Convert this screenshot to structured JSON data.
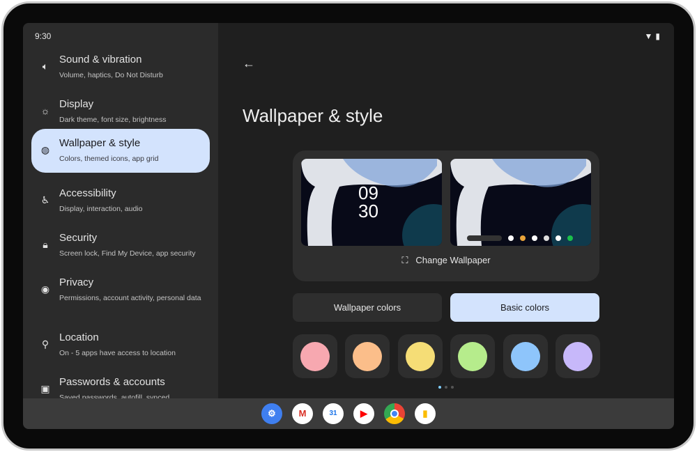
{
  "status": {
    "time": "9:30",
    "wifi_icon": "wifi-icon",
    "battery_icon": "battery-icon"
  },
  "sidebar": {
    "items": [
      {
        "title": "Sound & vibration",
        "subtitle": "Volume, haptics, Do Not Disturb",
        "icon": "volume-icon"
      },
      {
        "title": "Display",
        "subtitle": "Dark theme, font size, brightness",
        "icon": "brightness-icon"
      },
      {
        "title": "Wallpaper & style",
        "subtitle": "Colors, themed icons, app grid",
        "icon": "palette-icon",
        "selected": true
      },
      {
        "title": "Accessibility",
        "subtitle": "Display, interaction, audio",
        "icon": "accessibility-icon"
      },
      {
        "title": "Security",
        "subtitle": "Screen lock, Find My Device, app security",
        "icon": "lock-icon"
      },
      {
        "title": "Privacy",
        "subtitle": "Permissions, account activity, personal data",
        "icon": "eye-icon"
      },
      {
        "title": "Location",
        "subtitle": "On - 5 apps have access to location",
        "icon": "location-pin-icon"
      },
      {
        "title": "Passwords & accounts",
        "subtitle": "Saved passwords, autofill, synced",
        "icon": "account-box-icon"
      }
    ]
  },
  "main": {
    "title": "Wallpaper & style",
    "lock_clock_hours": "09",
    "lock_clock_minutes": "30",
    "change_wallpaper": "Change Wallpaper",
    "tabs": [
      {
        "label": "Wallpaper colors",
        "selected": false
      },
      {
        "label": "Basic colors",
        "selected": true
      }
    ],
    "swatches": [
      "#f7a8b0",
      "#fbbe8a",
      "#f5dd76",
      "#b6ec8c",
      "#8ec5fb",
      "#c7b8fa"
    ],
    "page_indicator": {
      "pages": 3,
      "current": 1
    }
  },
  "accent": "#d3e3fd",
  "taskbar": {
    "apps": [
      "Settings",
      "Gmail",
      "Calendar",
      "YouTube",
      "Chrome",
      "Keep"
    ],
    "calendar_day": "31"
  }
}
